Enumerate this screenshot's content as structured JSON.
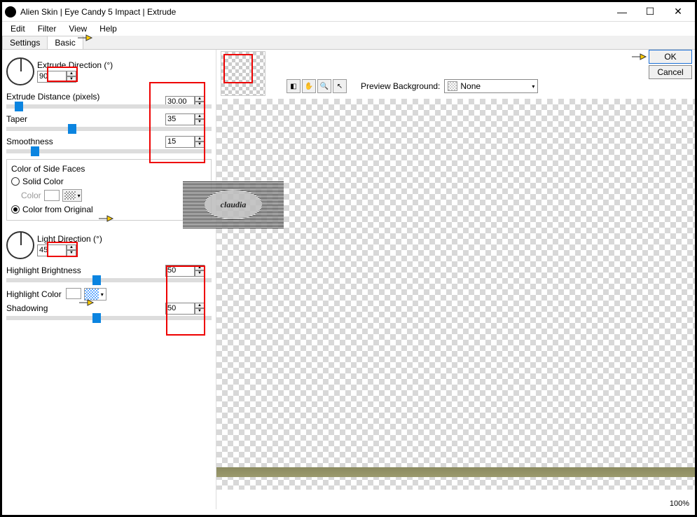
{
  "window": {
    "title": "Alien Skin | Eye Candy 5 Impact | Extrude"
  },
  "menu": {
    "edit": "Edit",
    "filter": "Filter",
    "view": "View",
    "help": "Help"
  },
  "tabs": {
    "settings": "Settings",
    "basic": "Basic"
  },
  "controls": {
    "extrude_direction": {
      "label": "Extrude Direction (°)",
      "value": "90"
    },
    "extrude_distance": {
      "label": "Extrude Distance (pixels)",
      "value": "30.00",
      "slider_pct": 6
    },
    "taper": {
      "label": "Taper",
      "value": "35",
      "slider_pct": 32
    },
    "smoothness": {
      "label": "Smoothness",
      "value": "15",
      "slider_pct": 14
    },
    "light_direction": {
      "label": "Light Direction (°)",
      "value": "45"
    },
    "highlight_brightness": {
      "label": "Highlight Brightness",
      "value": "50",
      "slider_pct": 44
    },
    "highlight_color": {
      "label": "Highlight Color"
    },
    "shadowing": {
      "label": "Shadowing",
      "value": "50",
      "slider_pct": 44
    }
  },
  "side_faces": {
    "group_label": "Color of Side Faces",
    "solid_color": "Solid Color",
    "color_label": "Color",
    "color_from_original": "Color from Original"
  },
  "preview": {
    "label": "Preview Background:",
    "value": "None"
  },
  "actions": {
    "ok": "OK",
    "cancel": "Cancel"
  },
  "zoom": "100%"
}
